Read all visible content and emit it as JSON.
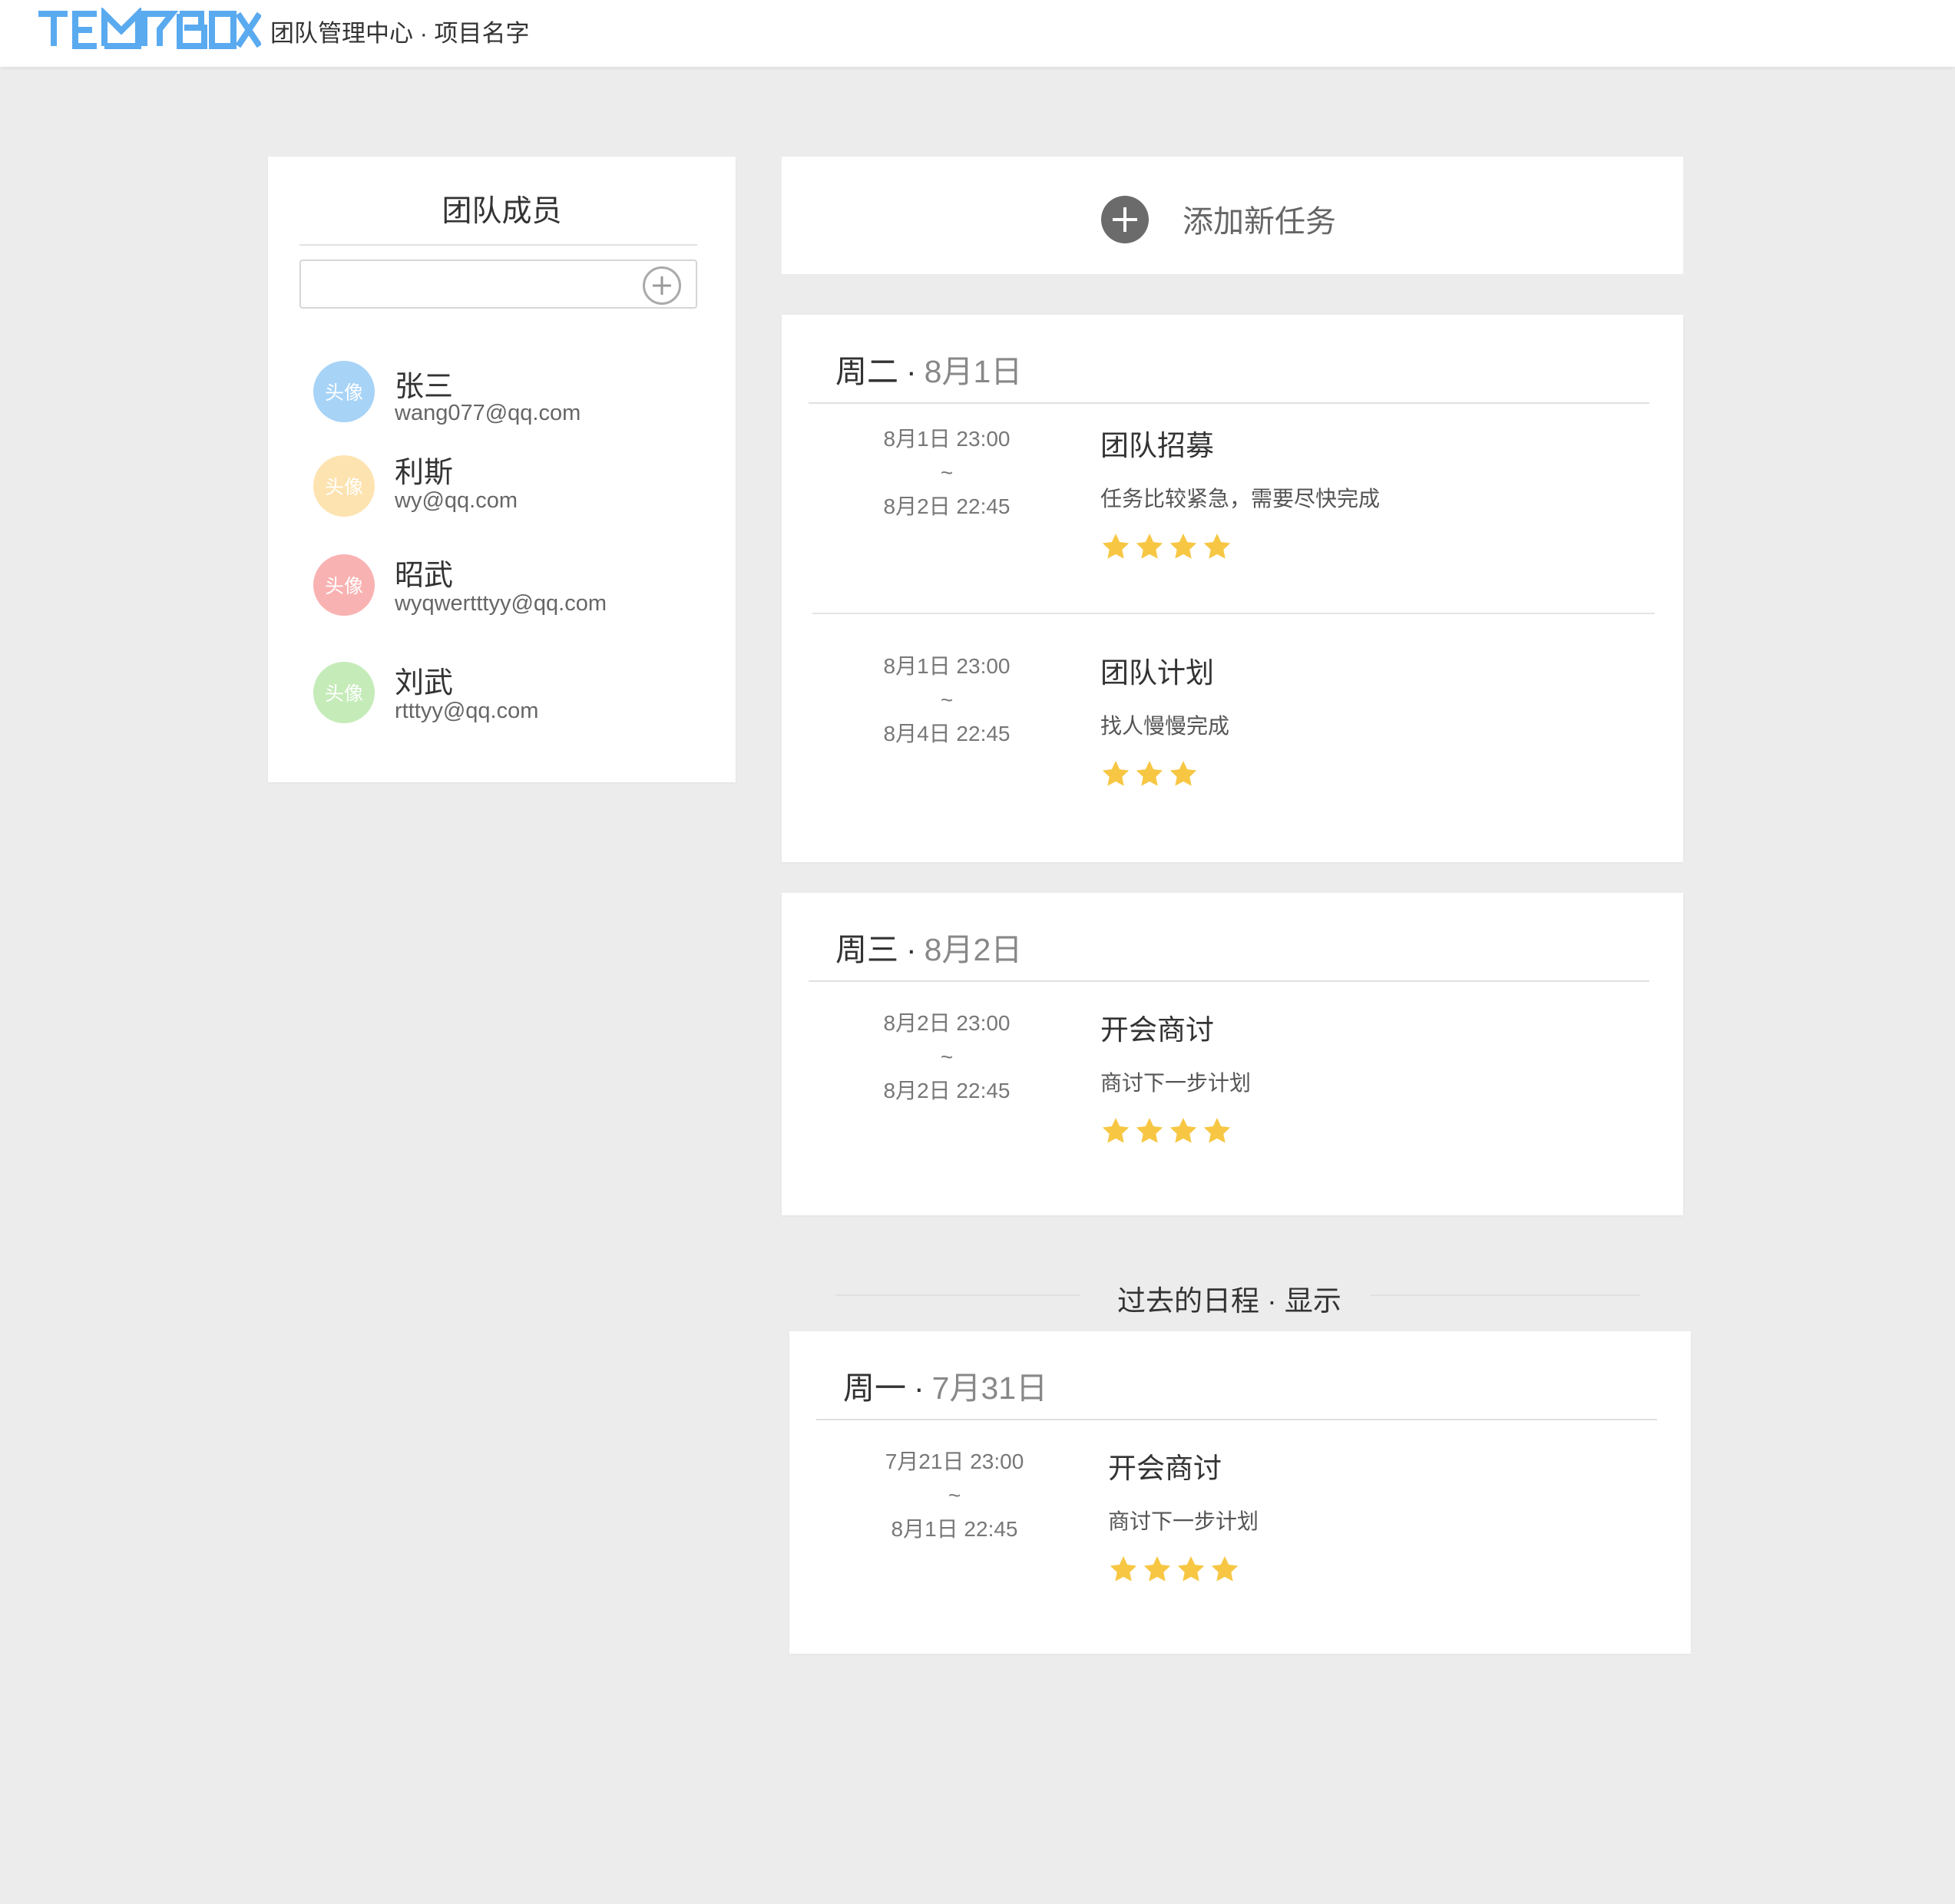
{
  "header": {
    "logo_text": "TEAMBOX",
    "title": "团队管理中心 · 项目名字",
    "logo_color": "#5aaaf0"
  },
  "members": {
    "title": "团队成员",
    "search_value": "",
    "add_icon": "plus-circle-icon",
    "list": [
      {
        "avatar_label": "头像",
        "name": "张三",
        "email": "wang077@qq.com",
        "color": "#a7d3f7"
      },
      {
        "avatar_label": "头像",
        "name": "利斯",
        "email": "wy@qq.com",
        "color": "#fde3b0"
      },
      {
        "avatar_label": "头像",
        "name": "昭武",
        "email": "wyqwertttyy@qq.com",
        "color": "#f9b2b2"
      },
      {
        "avatar_label": "头像",
        "name": "刘武",
        "email": "rtttyy@qq.com",
        "color": "#c5ebb9"
      }
    ]
  },
  "add_task": {
    "label": "添加新任务",
    "icon": "plus-circle-icon"
  },
  "days": [
    {
      "weekday": "周二",
      "dot": "·",
      "date": "8月1日",
      "tasks": [
        {
          "start": "8月1日 23:00",
          "sep": "~",
          "end": "8月2日 22:45",
          "title": "团队招募",
          "desc": "任务比较紧急，需要尽快完成",
          "stars": 4
        },
        {
          "start": "8月1日 23:00",
          "sep": "~",
          "end": "8月4日 22:45",
          "title": "团队计划",
          "desc": "找人慢慢完成",
          "stars": 3
        }
      ]
    },
    {
      "weekday": "周三",
      "dot": "·",
      "date": "8月2日",
      "tasks": [
        {
          "start": "8月2日 23:00",
          "sep": "~",
          "end": "8月2日 22:45",
          "title": "开会商讨",
          "desc": "商讨下一步计划",
          "stars": 4
        }
      ]
    }
  ],
  "past": {
    "label": "过去的日程",
    "dot": "·",
    "toggle": "显示",
    "days": [
      {
        "weekday": "周一",
        "dot": "·",
        "date": "7月31日",
        "tasks": [
          {
            "start": "7月21日 23:00",
            "sep": "~",
            "end": "8月1日 22:45",
            "title": "开会商讨",
            "desc": "商讨下一步计划",
            "stars": 4
          }
        ]
      }
    ]
  },
  "colors": {
    "background": "#ececec",
    "star": "#f7c744",
    "date_gray": "#888888"
  }
}
